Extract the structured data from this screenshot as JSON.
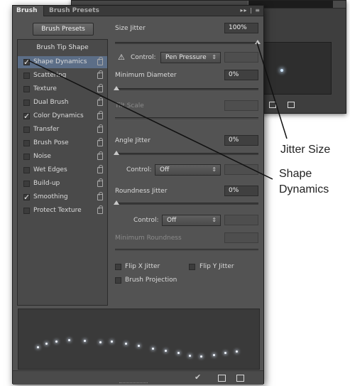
{
  "tabs": {
    "active": "Brush",
    "inactive": "Brush Presets",
    "menu": "▸▸ | ≡"
  },
  "left": {
    "presets_button": "Brush Presets",
    "tip_shape": "Brush Tip Shape",
    "options": [
      {
        "label": "Shape Dynamics",
        "checked": true,
        "selected": true
      },
      {
        "label": "Scattering",
        "checked": false,
        "selected": false
      },
      {
        "label": "Texture",
        "checked": false,
        "selected": false
      },
      {
        "label": "Dual Brush",
        "checked": false,
        "selected": false
      },
      {
        "label": "Color Dynamics",
        "checked": true,
        "selected": false
      },
      {
        "label": "Transfer",
        "checked": false,
        "selected": false
      },
      {
        "label": "Brush Pose",
        "checked": false,
        "selected": false
      },
      {
        "label": "Noise",
        "checked": false,
        "selected": false
      },
      {
        "label": "Wet Edges",
        "checked": false,
        "selected": false
      },
      {
        "label": "Build-up",
        "checked": false,
        "selected": false
      },
      {
        "label": "Smoothing",
        "checked": true,
        "selected": false
      },
      {
        "label": "Protect Texture",
        "checked": false,
        "selected": false
      }
    ]
  },
  "right": {
    "size_jitter": {
      "label": "Size Jitter",
      "value": "100%",
      "level": 1.0
    },
    "control1": {
      "label": "Control:",
      "value": "Pen Pressure"
    },
    "min_diameter": {
      "label": "Minimum Diameter",
      "value": "0%",
      "level": 0.0
    },
    "tilt_scale": {
      "label": "Tilt Scale"
    },
    "angle_jitter": {
      "label": "Angle Jitter",
      "value": "0%",
      "level": 0.0
    },
    "control2": {
      "label": "Control:",
      "value": "Off"
    },
    "roundness_jitter": {
      "label": "Roundness Jitter",
      "value": "0%",
      "level": 0.0
    },
    "control3": {
      "label": "Control:",
      "value": "Off"
    },
    "min_roundness": {
      "label": "Minimum Roundness"
    },
    "flip_x": "Flip X Jitter",
    "flip_y": "Flip Y Jitter",
    "projection": "Brush Projection"
  },
  "callouts": {
    "jitter_size": "Jitter Size",
    "shape_line1": "Shape",
    "shape_line2": "Dynamics"
  }
}
